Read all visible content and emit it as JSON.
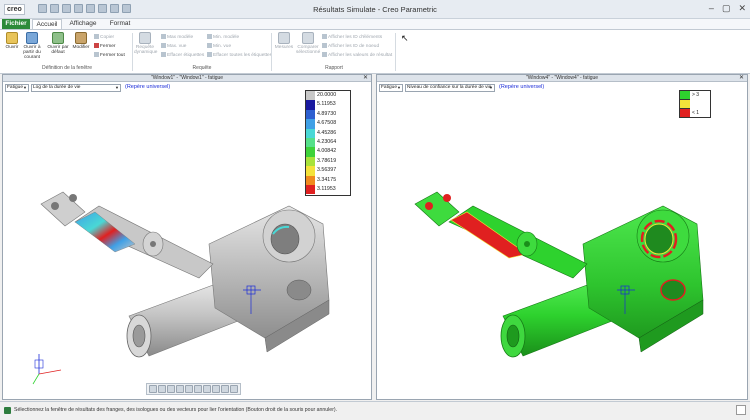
{
  "app": {
    "logo": "creo",
    "title": "Résultats Simulate - Creo Parametric"
  },
  "tabs": [
    "Fichier",
    "Accueil",
    "Affichage",
    "Format"
  ],
  "ribbon": {
    "group_file_label": "Définition de la fenêtre",
    "group_query_label": "Requête",
    "group_report_label": "Rapport",
    "btn_open": "Ouvrir",
    "btn_open_from_current": "Ouvrir à partir du courant",
    "btn_open_default": "Ouvrir par défaut",
    "btn_modify": "Modifier",
    "btn_copy": "Copier",
    "btn_close": "Fermer",
    "btn_close_all": "Fermer tout",
    "btn_dynamic_query": "Requête dynamique",
    "btn_max_model": "Max modèle",
    "btn_max_view": "Max. vue",
    "btn_clear_labels": "Effacer étiquettes",
    "btn_min_model": "Min. modèle",
    "btn_min_view": "Min. vue",
    "btn_clear_all_labels": "Effacer toutes les étiquettes",
    "btn_measures": "Mesures",
    "btn_compare_selected": "Comparer sélectionné",
    "btn_show_element_ids": "Afficher les ID d'éléments",
    "btn_show_node_ids": "Afficher les ID de noeud",
    "btn_show_result_values": "Afficher les valeurs de résultat"
  },
  "left_window": {
    "title": "\"Window1\" - \"Window1\" - fatigue",
    "analysis_select": "Fatigue",
    "quantity_select": "Log de la durée de vie",
    "ref_label": "(Repère universel)",
    "legend_values": [
      "20.0000",
      "5.11953",
      "4.89730",
      "4.67508",
      "4.45286",
      "4.23064",
      "4.00842",
      "3.78619",
      "3.56397",
      "3.34175",
      "3.11953"
    ],
    "legend_colors": [
      "#c8c8c8",
      "#1a1aa0",
      "#2d5fd0",
      "#3fa0e6",
      "#49d8d6",
      "#55e08a",
      "#3ed23a",
      "#a8e23a",
      "#f4e23a",
      "#f08a1e",
      "#e02020"
    ]
  },
  "right_window": {
    "title": "\"Window4\" - \"Window4\" - fatigue",
    "analysis_select": "Fatigue",
    "quantity_select": "Niveau de confiance sur la durée de vie",
    "ref_label": "(Repère universel)",
    "legend_entries": [
      {
        "label": "> 3",
        "color": "#2ed22e"
      },
      {
        "label": "",
        "color": "#f2e23a"
      },
      {
        "label": "< 1",
        "color": "#e02020"
      }
    ]
  },
  "status": {
    "message": "Sélectionnez la fenêtre de résultats des franges, des isologues ou des vecteurs pour lier l'orientation (Bouton droit de la souris pour annuler)."
  }
}
